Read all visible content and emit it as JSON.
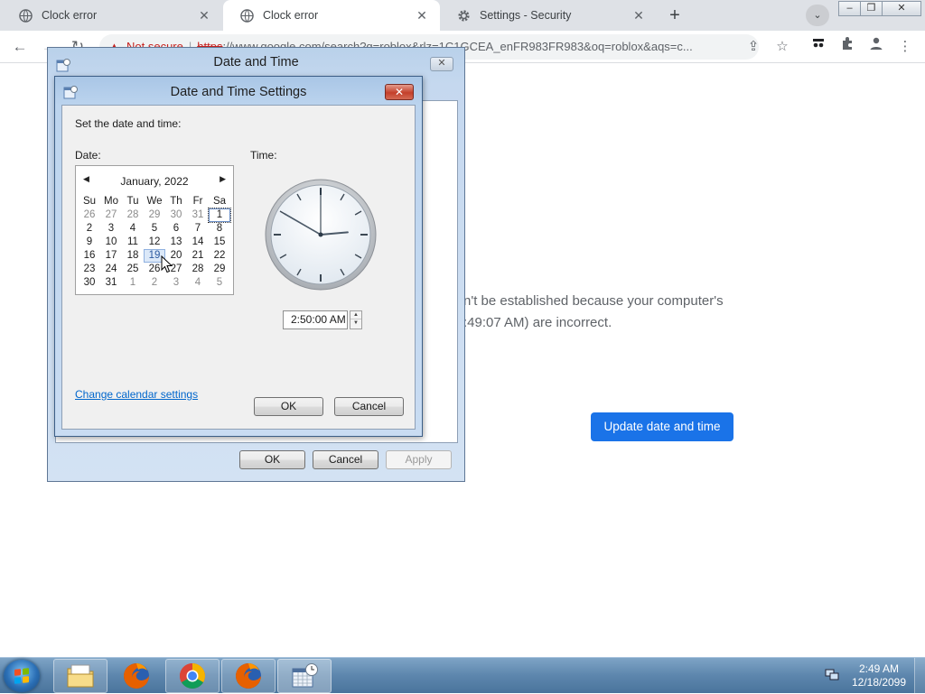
{
  "browser": {
    "tabs": [
      {
        "title": "Clock error",
        "active": false
      },
      {
        "title": "Clock error",
        "active": true
      },
      {
        "title": "Settings - Security",
        "active": false
      }
    ],
    "address": {
      "security_label": "Not secure",
      "scheme": "https",
      "url": "://www.google.com/search?q=roblox&rlz=1C1GCEA_enFR983FR983&oq=roblox&aqs=c..."
    }
  },
  "page": {
    "error_line1": "n't be established because your computer's",
    "error_line2": ":49:07 AM) are incorrect.",
    "update_button": "Update date and time"
  },
  "outer_dialog": {
    "title": "Date and Time",
    "ok": "OK",
    "cancel": "Cancel",
    "apply": "Apply"
  },
  "inner_dialog": {
    "title": "Date and Time Settings",
    "instruction": "Set the date and time:",
    "date_label": "Date:",
    "time_label": "Time:",
    "calendar": {
      "month_year": "January, 2022",
      "weekdays": [
        "Su",
        "Mo",
        "Tu",
        "We",
        "Th",
        "Fr",
        "Sa"
      ],
      "days": [
        {
          "d": "26",
          "t": "dim"
        },
        {
          "d": "27",
          "t": "dim"
        },
        {
          "d": "28",
          "t": "dim"
        },
        {
          "d": "29",
          "t": "dim"
        },
        {
          "d": "30",
          "t": "dim"
        },
        {
          "d": "31",
          "t": "dim"
        },
        {
          "d": "1",
          "t": "today"
        },
        {
          "d": "2",
          "t": ""
        },
        {
          "d": "3",
          "t": ""
        },
        {
          "d": "4",
          "t": ""
        },
        {
          "d": "5",
          "t": ""
        },
        {
          "d": "6",
          "t": ""
        },
        {
          "d": "7",
          "t": ""
        },
        {
          "d": "8",
          "t": ""
        },
        {
          "d": "9",
          "t": ""
        },
        {
          "d": "10",
          "t": ""
        },
        {
          "d": "11",
          "t": ""
        },
        {
          "d": "12",
          "t": ""
        },
        {
          "d": "13",
          "t": ""
        },
        {
          "d": "14",
          "t": ""
        },
        {
          "d": "15",
          "t": ""
        },
        {
          "d": "16",
          "t": ""
        },
        {
          "d": "17",
          "t": ""
        },
        {
          "d": "18",
          "t": ""
        },
        {
          "d": "19",
          "t": "sel"
        },
        {
          "d": "20",
          "t": ""
        },
        {
          "d": "21",
          "t": ""
        },
        {
          "d": "22",
          "t": ""
        },
        {
          "d": "23",
          "t": ""
        },
        {
          "d": "24",
          "t": ""
        },
        {
          "d": "25",
          "t": ""
        },
        {
          "d": "26",
          "t": ""
        },
        {
          "d": "27",
          "t": ""
        },
        {
          "d": "28",
          "t": ""
        },
        {
          "d": "29",
          "t": ""
        },
        {
          "d": "30",
          "t": ""
        },
        {
          "d": "31",
          "t": ""
        },
        {
          "d": "1",
          "t": "dim"
        },
        {
          "d": "2",
          "t": "dim"
        },
        {
          "d": "3",
          "t": "dim"
        },
        {
          "d": "4",
          "t": "dim"
        },
        {
          "d": "5",
          "t": "dim"
        }
      ]
    },
    "clock": {
      "hours": 2,
      "minutes": 50,
      "seconds": 0
    },
    "time_value": "2:50:00 AM",
    "change_calendar_link": "Change calendar settings",
    "ok": "OK",
    "cancel": "Cancel"
  },
  "taskbar": {
    "time": "2:49 AM",
    "date": "12/18/2099"
  },
  "colors": {
    "accent_blue": "#1a73e8",
    "link": "#0066cc",
    "taskbar": "#5d86ad"
  }
}
